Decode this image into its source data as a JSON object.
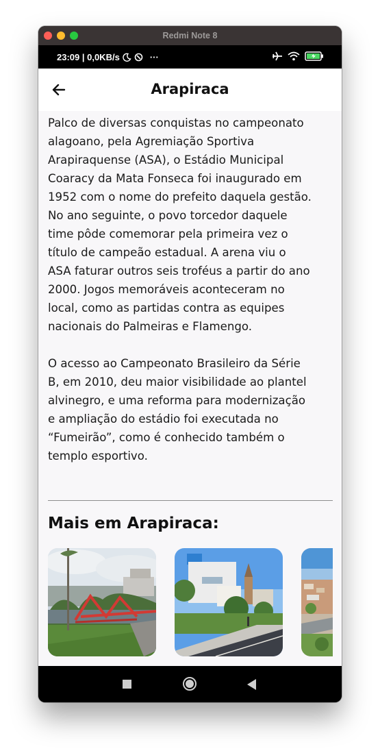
{
  "window": {
    "title": "Redmi Note 8"
  },
  "statusbar": {
    "time_speed": "23:09 | 0,0KB/s",
    "more": "···"
  },
  "appbar": {
    "title": "Arapiraca"
  },
  "article": {
    "paragraphs": [
      "Palco de diversas conquistas no campeonato\nalagoano, pela Agremiação Sportiva\nArapiraquense (ASA), o Estádio Municipal\nCoaracy da Mata Fonseca foi inaugurado em\n1952 com o nome do prefeito daquela gestão.\nNo ano seguinte, o povo torcedor daquele\ntime pôde comemorar pela primeira vez o\ntítulo de campeão estadual. A arena viu o\nASA faturar outros seis troféus a partir do ano\n2000. Jogos memoráveis aconteceram no\nlocal, como as partidas contra as equipes\nnacionais do Palmeiras e Flamengo.",
      "O acesso ao Campeonato Brasileiro da Série\nB, em 2010, deu maior visibilidade ao plantel\nalvinegro, e uma reforma para modernização\ne ampliação do estádio foi executada no\n“Fumeirão”, como é conhecido também o\ntemplo esportivo."
    ]
  },
  "more_section": {
    "title": "Mais em Arapiraca:"
  },
  "colors": {
    "accent_red": "#d23a34",
    "screen_bg": "#f8f7f9",
    "text": "#1a1a1a"
  }
}
